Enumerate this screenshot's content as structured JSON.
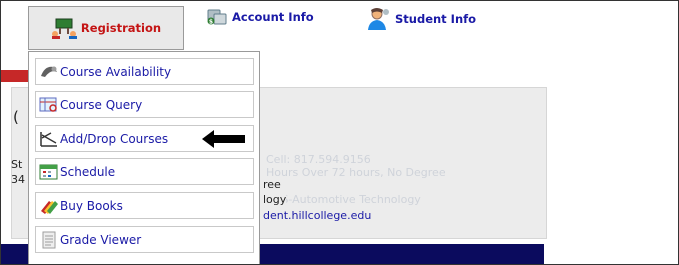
{
  "tabs": [
    {
      "label": "Registration",
      "icon": "registration-icon",
      "active": true
    },
    {
      "label": "Account Info",
      "icon": "account-info-icon",
      "active": false
    },
    {
      "label": "Student Info",
      "icon": "student-info-icon",
      "active": false
    }
  ],
  "menu": {
    "items": [
      {
        "label": "Course Availability",
        "icon": "course-availability-icon"
      },
      {
        "label": "Course Query",
        "icon": "course-query-icon"
      },
      {
        "label": "Add/Drop Courses",
        "icon": "add-drop-courses-icon"
      },
      {
        "label": "Schedule",
        "icon": "schedule-icon"
      },
      {
        "label": "Buy Books",
        "icon": "buy-books-icon"
      },
      {
        "label": "Grade Viewer",
        "icon": "grade-viewer-icon"
      }
    ]
  },
  "background": {
    "paren_text": "(",
    "st_text": "St",
    "num_text": "34",
    "cell_text": "Cell: 817.594.9156",
    "hours_text": "Hours Over 72 hours, No Degree",
    "ree_text": "ree",
    "program_text": "AAS-Automotive Technology",
    "logy_text": "logy",
    "email_text": "dent.hillcollege.edu"
  },
  "colors": {
    "tab_active_text": "#c41414",
    "tab_text": "#1a1aa6",
    "menu_link": "#1a1aa6",
    "navy_bar": "#0b0b5e",
    "panel_bg": "#ececec"
  }
}
